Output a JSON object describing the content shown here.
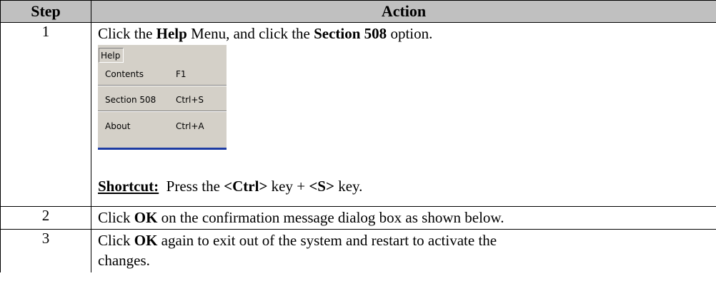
{
  "headers": {
    "step": "Step",
    "action": "Action"
  },
  "rows": [
    {
      "step": "1",
      "parts": [
        "Click the ",
        "Help",
        " Menu, and click the ",
        "Section 508",
        " option."
      ],
      "menu": {
        "title": "Help",
        "items": [
          {
            "label": "Contents",
            "shortcut": "F1"
          },
          {
            "label": "Section 508",
            "shortcut": "Ctrl+S"
          },
          {
            "label": "About",
            "shortcut": "Ctrl+A"
          }
        ]
      },
      "shortcut_line": {
        "label": "Shortcut:",
        "text_a": "  Press the ",
        "key1": "<Ctrl>",
        "text_b": " key + ",
        "key2": "<S>",
        "text_c": " key."
      }
    },
    {
      "step": "2",
      "parts": [
        "Click ",
        "OK",
        " on the confirmation message dialog box as shown below."
      ]
    },
    {
      "step": "3",
      "parts": [
        "Click ",
        "OK",
        " again to exit out of the system and restart to activate the"
      ],
      "line2": "changes."
    }
  ]
}
